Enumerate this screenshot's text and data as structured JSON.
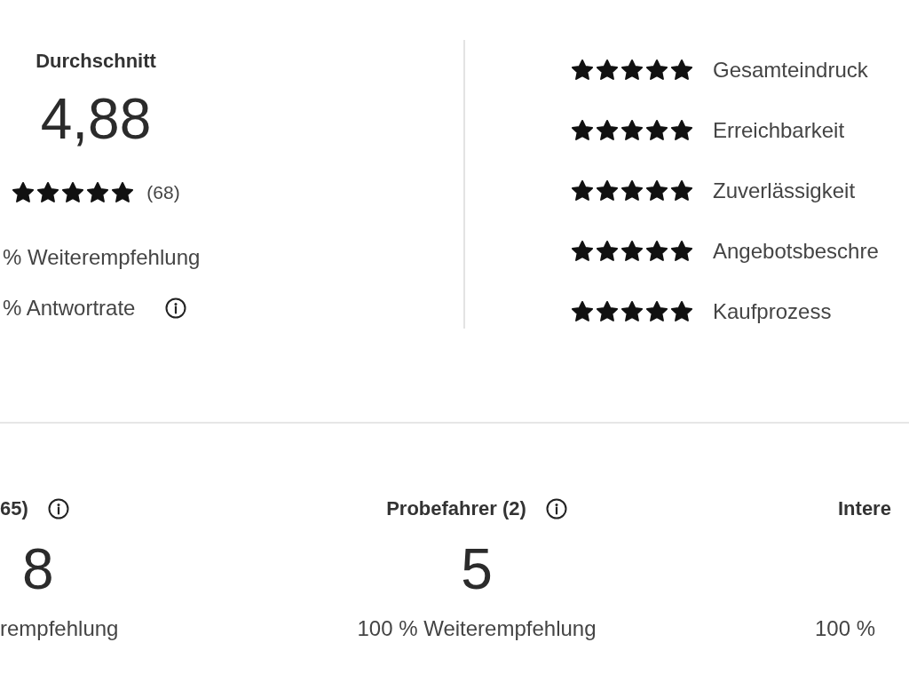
{
  "summary": {
    "title": "Durchschnitt",
    "score": "4,88",
    "stars": 5,
    "count": "(68)",
    "stats": [
      {
        "text": "% Weiterempfehlung",
        "info": false
      },
      {
        "text": "% Antwortrate",
        "info": true
      }
    ]
  },
  "criteria": [
    {
      "stars": 5,
      "label": "Gesamteindruck"
    },
    {
      "stars": 5,
      "label": "Erreichbarkeit"
    },
    {
      "stars": 5,
      "label": "Zuverlässigkeit"
    },
    {
      "stars": 5,
      "label": "Angebotsbeschre"
    },
    {
      "stars": 5,
      "label": "Kaufprozess"
    }
  ],
  "groups": [
    {
      "title": "65)",
      "info": true,
      "score": "8",
      "recommendation": "rempfehlung"
    },
    {
      "title": "Probefahrer (2)",
      "info": true,
      "score": "5",
      "recommendation": "100 % Weiterempfehlung"
    },
    {
      "title": "Intere",
      "info": false,
      "recommendation": "100 %"
    }
  ]
}
